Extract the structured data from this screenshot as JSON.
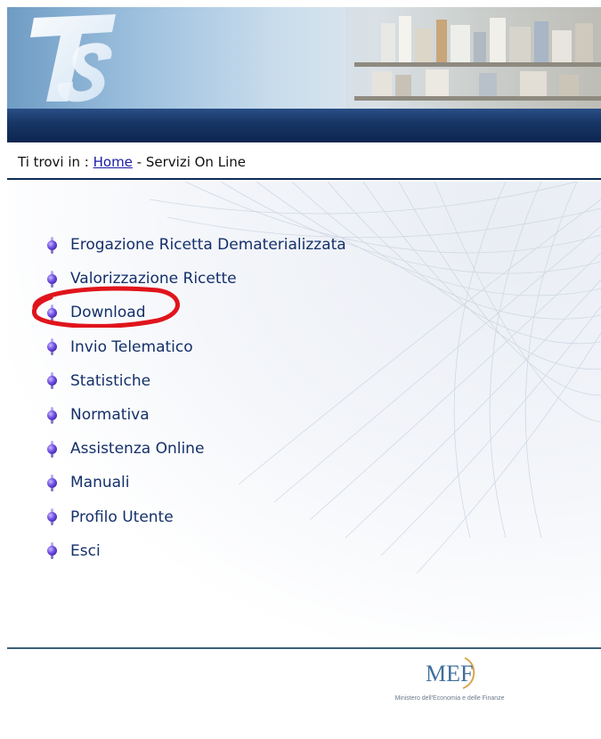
{
  "header": {
    "logo_text": "TS"
  },
  "breadcrumb": {
    "prefix": "Ti trovi in : ",
    "home_link": "Home",
    "separator": " - ",
    "current": "Servizi On Line"
  },
  "menu": {
    "items": [
      {
        "label": "Erogazione Ricetta Dematerializzata"
      },
      {
        "label": "Valorizzazione Ricette"
      },
      {
        "label": "Download"
      },
      {
        "label": "Invio Telematico"
      },
      {
        "label": "Statistiche"
      },
      {
        "label": "Normativa"
      },
      {
        "label": "Assistenza Online"
      },
      {
        "label": "Manuali"
      },
      {
        "label": "Profilo Utente"
      },
      {
        "label": "Esci"
      }
    ]
  },
  "annotation": {
    "highlight_color": "#e0141c",
    "highlighted_item": "Download"
  },
  "footer": {
    "logo_text": "MEF",
    "caption": "Ministero dell'Economia e delle Finanze"
  },
  "colors": {
    "navbar": "#173766",
    "link": "#14306a",
    "footer_line": "#3b5f78"
  }
}
